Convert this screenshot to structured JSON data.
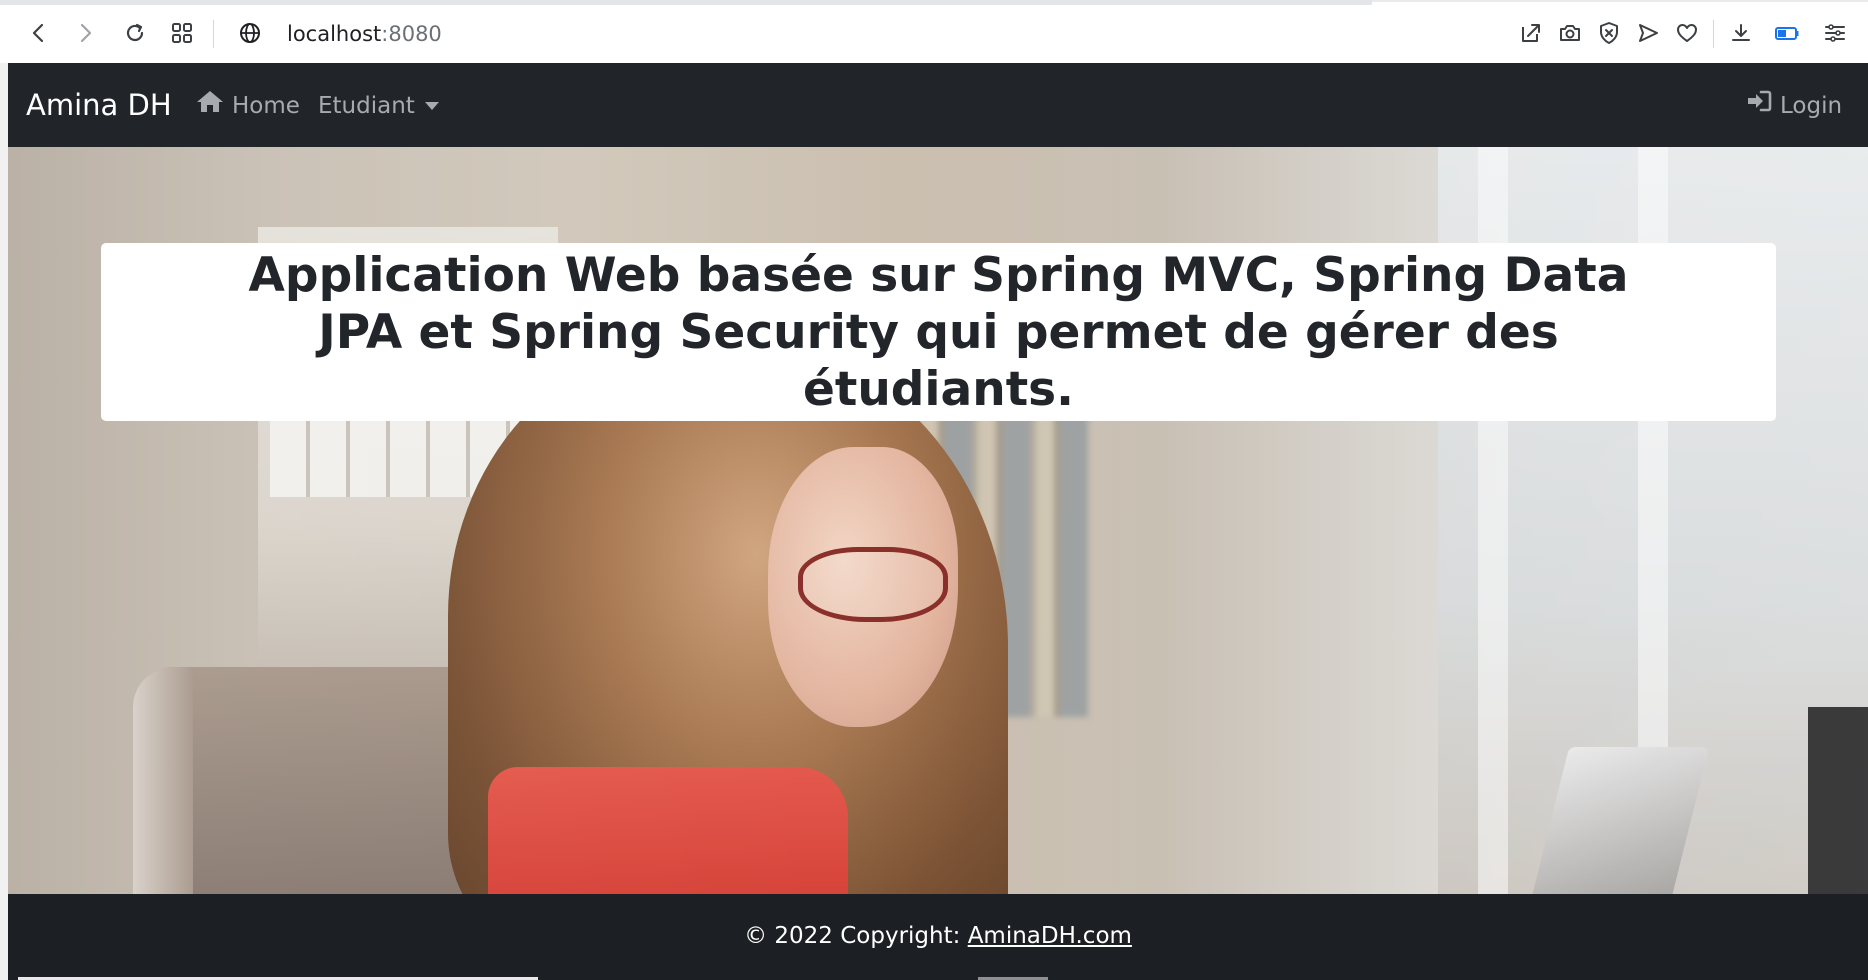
{
  "browser": {
    "url_host": "localhost",
    "url_port": ":8080",
    "toolbar_icons": [
      "back-icon",
      "forward-icon",
      "reload-icon",
      "apps-grid-icon",
      "globe-icon",
      "share-edit-icon",
      "camera-icon",
      "shield-x-icon",
      "send-icon",
      "heart-icon",
      "download-icon",
      "battery-icon",
      "menu-icon"
    ]
  },
  "navbar": {
    "brand": "Amina DH",
    "home_label": "Home",
    "etudiant_label": "Etudiant",
    "login_label": "Login"
  },
  "hero": {
    "title": "Application Web basée sur Spring MVC, Spring Data JPA et Spring Security qui permet de gérer des étudiants."
  },
  "footer": {
    "copyright_prefix": "© 2022 Copyright: ",
    "copyright_link": "AminaDH.com"
  },
  "colors": {
    "navbar_bg": "#21252a",
    "footer_bg": "#1c1f23",
    "nav_link": "#a7abb0",
    "accent_blue": "#1a73e8"
  }
}
